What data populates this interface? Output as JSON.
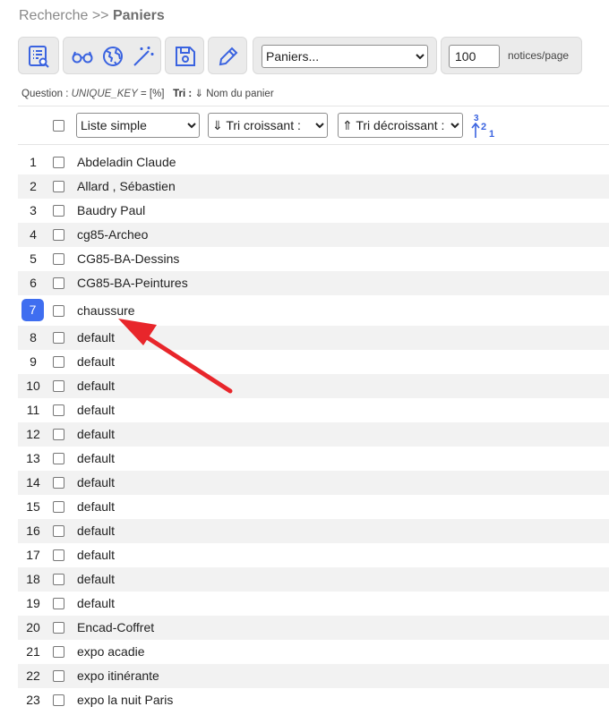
{
  "breadcrumb": {
    "root": "Recherche",
    "separator": ">>",
    "current": "Paniers"
  },
  "toolbar": {
    "basket_select": {
      "value": "Paniers...",
      "options": [
        "Paniers..."
      ]
    },
    "per_page": {
      "value": "100",
      "suffix": "notices/page"
    }
  },
  "question": {
    "label": "Question :",
    "key": "UNIQUE_KEY",
    "rest": "= [%]",
    "sort_label": "Tri :",
    "sort_value": "⇓ Nom du panier"
  },
  "list_controls": {
    "display": "Liste simple",
    "sort_asc": "⇓ Tri croissant :",
    "sort_desc": "⇑ Tri décroissant :",
    "sort_icon_top": "3",
    "sort_icon_mid": "2",
    "sort_icon_bot": "1"
  },
  "rows": [
    {
      "num": "1",
      "label": "Abdeladin Claude"
    },
    {
      "num": "2",
      "label": "Allard , Sébastien"
    },
    {
      "num": "3",
      "label": "Baudry Paul"
    },
    {
      "num": "4",
      "label": "cg85-Archeo"
    },
    {
      "num": "5",
      "label": "CG85-BA-Dessins"
    },
    {
      "num": "6",
      "label": "CG85-BA-Peintures"
    },
    {
      "num": "7",
      "label": "chaussure"
    },
    {
      "num": "8",
      "label": "default"
    },
    {
      "num": "9",
      "label": "default"
    },
    {
      "num": "10",
      "label": "default"
    },
    {
      "num": "11",
      "label": "default"
    },
    {
      "num": "12",
      "label": "default"
    },
    {
      "num": "13",
      "label": "default"
    },
    {
      "num": "14",
      "label": "default"
    },
    {
      "num": "15",
      "label": "default"
    },
    {
      "num": "16",
      "label": "default"
    },
    {
      "num": "17",
      "label": "default"
    },
    {
      "num": "18",
      "label": "default"
    },
    {
      "num": "19",
      "label": "default"
    },
    {
      "num": "20",
      "label": "Encad-Coffret"
    },
    {
      "num": "21",
      "label": "expo acadie"
    },
    {
      "num": "22",
      "label": "expo itinérante"
    },
    {
      "num": "23",
      "label": "expo la nuit Paris"
    }
  ],
  "selected_row": "7",
  "colors": {
    "accent": "#3f6ef0",
    "arrow": "#e8262b",
    "icon": "#3a63e0"
  },
  "icons": [
    "list-search-icon",
    "glasses-icon",
    "globe-icon",
    "magic-wand-icon",
    "save-icon",
    "pencil-icon",
    "sort-numeric-icon"
  ]
}
